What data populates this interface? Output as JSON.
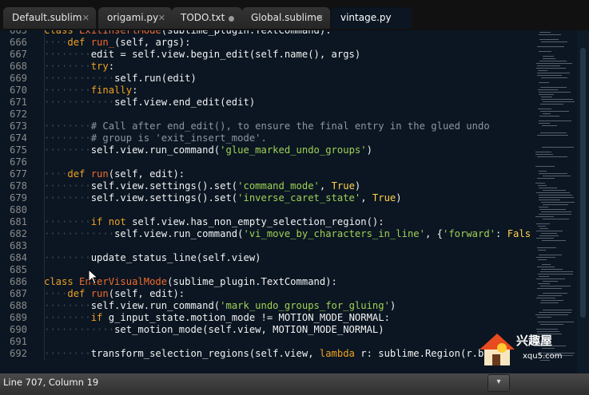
{
  "tabs": [
    {
      "label": "Default.sublim",
      "state": "close"
    },
    {
      "label": "origami.py",
      "state": "close"
    },
    {
      "label": "TODO.txt",
      "state": "dirty"
    },
    {
      "label": "Global.sublime",
      "state": "close"
    },
    {
      "label": "vintage.py",
      "state": "active"
    }
  ],
  "editor": {
    "lines": [
      {
        "n": "665",
        "t": "class ExitInsertMode(sublime_plugin.TextCommand):"
      },
      {
        "n": "666",
        "t": "    def run_(self, args):"
      },
      {
        "n": "667",
        "t": "        edit = self.view.begin_edit(self.name(), args)"
      },
      {
        "n": "668",
        "t": "        try:"
      },
      {
        "n": "669",
        "t": "            self.run(edit)"
      },
      {
        "n": "670",
        "t": "        finally:"
      },
      {
        "n": "671",
        "t": "            self.view.end_edit(edit)"
      },
      {
        "n": "672",
        "t": ""
      },
      {
        "n": "673",
        "t": "        # Call after end_edit(), to ensure the final entry in the glued undo"
      },
      {
        "n": "674",
        "t": "        # group is 'exit_insert_mode'."
      },
      {
        "n": "675",
        "t": "        self.view.run_command('glue_marked_undo_groups')"
      },
      {
        "n": "676",
        "t": ""
      },
      {
        "n": "677",
        "t": "    def run(self, edit):"
      },
      {
        "n": "678",
        "t": "        self.view.settings().set('command_mode', True)"
      },
      {
        "n": "679",
        "t": "        self.view.settings().set('inverse_caret_state', True)"
      },
      {
        "n": "680",
        "t": ""
      },
      {
        "n": "681",
        "t": "        if not self.view.has_non_empty_selection_region():"
      },
      {
        "n": "682",
        "t": "            self.view.run_command('vi_move_by_characters_in_line', {'forward': False})"
      },
      {
        "n": "683",
        "t": ""
      },
      {
        "n": "684",
        "t": "        update_status_line(self.view)"
      },
      {
        "n": "685",
        "t": ""
      },
      {
        "n": "686",
        "t": "class EnterVisualMode(sublime_plugin.TextCommand):"
      },
      {
        "n": "687",
        "t": "    def run(self, edit):"
      },
      {
        "n": "688",
        "t": "        self.view.run_command('mark_undo_groups_for_gluing')"
      },
      {
        "n": "689",
        "t": "        if g_input_state.motion_mode != MOTION_MODE_NORMAL:"
      },
      {
        "n": "690",
        "t": "            set_motion_mode(self.view, MOTION_MODE_NORMAL)"
      },
      {
        "n": "691",
        "t": ""
      },
      {
        "n": "692",
        "t": "        transform_selection_regions(self.view, lambda r: sublime.Region(r.b,"
      }
    ]
  },
  "status": {
    "text": "Line 707, Column 19"
  },
  "watermark": {
    "text": "兴趣屋",
    "url": "xqu5.com"
  },
  "colors": {
    "keyword": "#f0a020",
    "function": "#f26a2c",
    "string": "#9fd154",
    "comment": "#8d96a0",
    "constant": "#ffd24a",
    "background": "#0b1622"
  }
}
